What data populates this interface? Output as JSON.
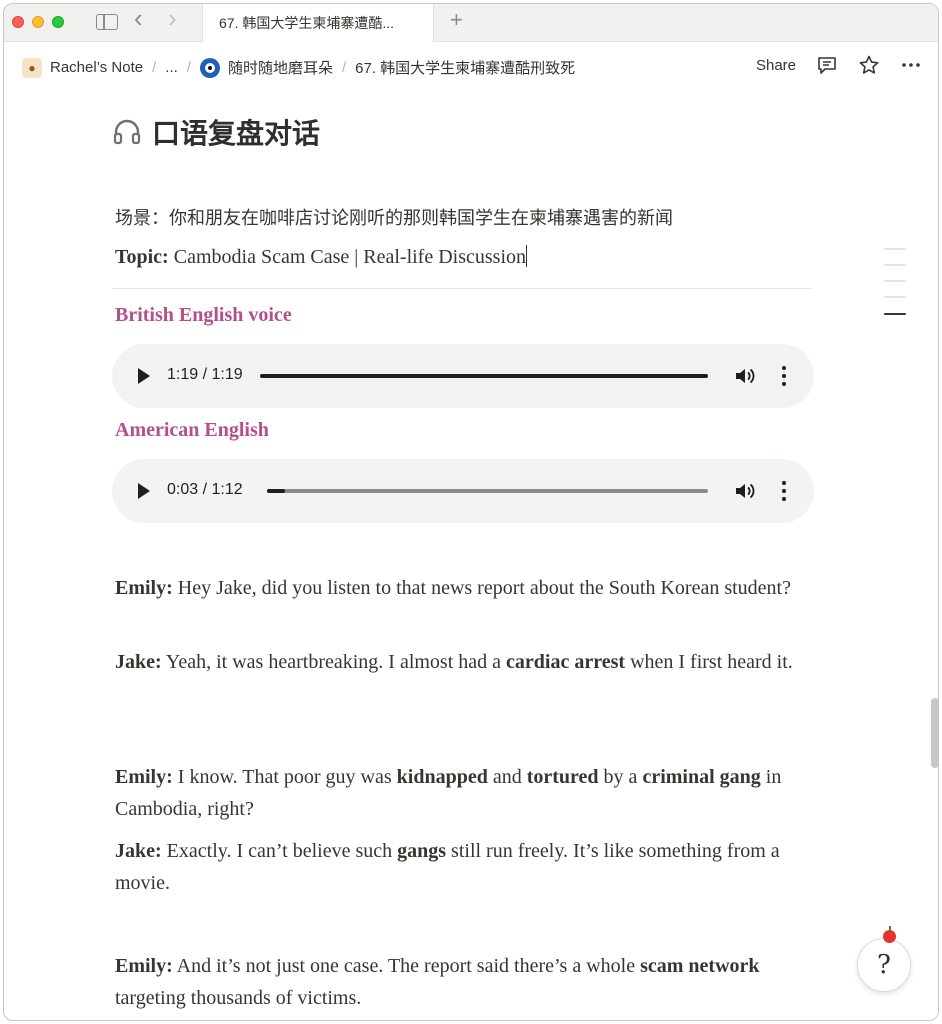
{
  "browser": {
    "tab_title": "67. 韩国大学生柬埔寨遭酷...",
    "new_tab_symbol": "+",
    "back_symbol": "‹",
    "forward_symbol": "›"
  },
  "breadcrumb": {
    "items": [
      {
        "label": "Rachel’s Note"
      },
      {
        "label": "..."
      },
      {
        "label": "随时随地磨耳朵"
      },
      {
        "label": "67. 韩国大学生柬埔寨遭酷刑致死"
      }
    ],
    "separator": "/"
  },
  "actions": {
    "share_label": "Share"
  },
  "page": {
    "title": "口语复盘对话",
    "scene": "场景：你和朋友在咖啡店讨论刚听的那则韩国学生在柬埔寨遇害的新闻",
    "topic_label": "Topic:",
    "topic_text": " Cambodia Scam Case | Real-life Discussion"
  },
  "audio": [
    {
      "heading": "British English voice",
      "time": "1:19 / 1:19",
      "progress": 1.0
    },
    {
      "heading": "American English",
      "time": "0:03 / 1:12",
      "progress": 0.04
    }
  ],
  "dialogue": [
    {
      "speaker": "Emily:",
      "parts": [
        {
          "t": " Hey Jake, did you listen to that news report about the South Korean student?",
          "b": false
        }
      ]
    },
    {
      "speaker": "Jake:",
      "parts": [
        {
          "t": " Yeah, it was heartbreaking. I almost had a ",
          "b": false
        },
        {
          "t": "cardiac arrest",
          "b": true
        },
        {
          "t": " when I first heard it.",
          "b": false
        }
      ]
    },
    {
      "speaker": "Emily:",
      "parts": [
        {
          "t": " I know. That poor guy was ",
          "b": false
        },
        {
          "t": "kidnapped",
          "b": true
        },
        {
          "t": " and ",
          "b": false
        },
        {
          "t": "tortured",
          "b": true
        },
        {
          "t": " by a ",
          "b": false
        },
        {
          "t": "criminal gang",
          "b": true
        },
        {
          "t": " in Cambodia, right?",
          "b": false
        }
      ]
    },
    {
      "speaker": "Jake:",
      "parts": [
        {
          "t": " Exactly. I can’t believe such ",
          "b": false
        },
        {
          "t": "gangs",
          "b": true
        },
        {
          "t": " still run freely. It’s like something from a movie.",
          "b": false
        }
      ]
    },
    {
      "speaker": "Emily:",
      "parts": [
        {
          "t": " And it’s not just one case. The report said there’s a whole ",
          "b": false
        },
        {
          "t": "scam network",
          "b": true
        },
        {
          "t": " targeting thousands of victims.",
          "b": false
        }
      ]
    }
  ],
  "help_button": {
    "label": "?"
  },
  "colors": {
    "voice_heading": "#b34f8a",
    "player_bg": "#f1f3f4"
  }
}
